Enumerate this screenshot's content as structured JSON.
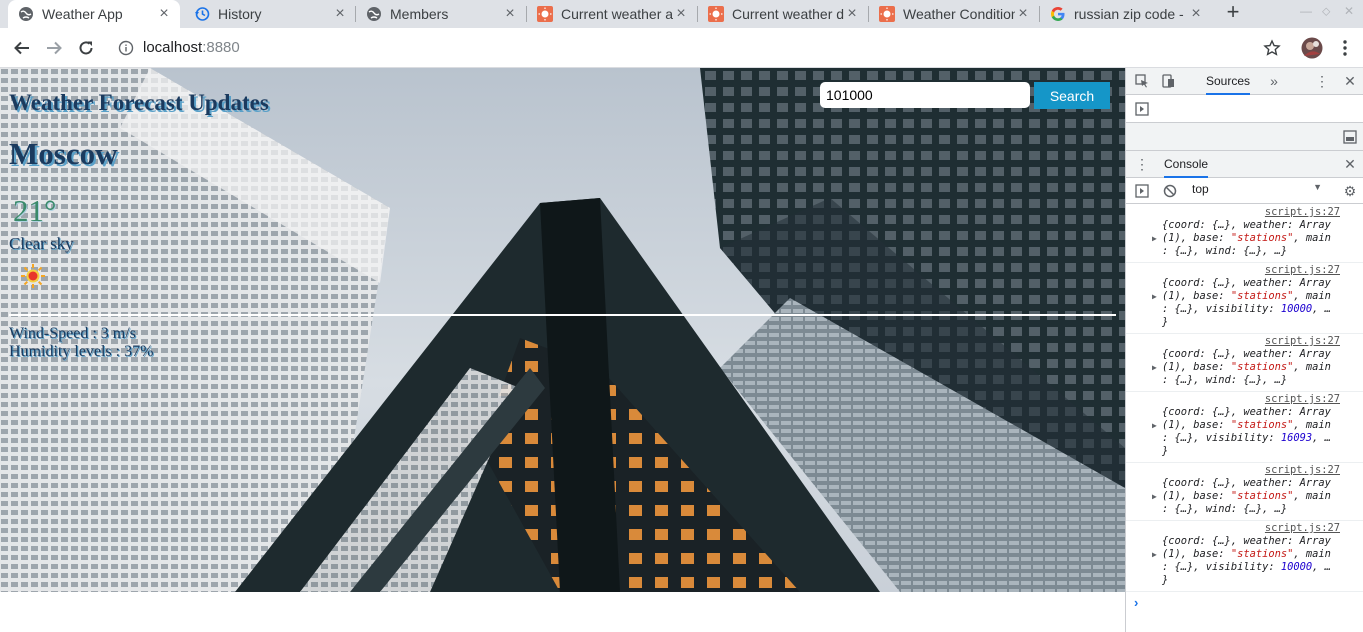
{
  "browser": {
    "tabs": [
      {
        "title": "Weather App",
        "icon": "globe-icon",
        "active": true
      },
      {
        "title": "History",
        "icon": "history-icon",
        "active": false
      },
      {
        "title": "Members",
        "icon": "globe-icon",
        "active": false
      },
      {
        "title": "Current weather ar",
        "icon": "openweather-icon",
        "active": false
      },
      {
        "title": "Current weather da",
        "icon": "openweather-icon",
        "active": false
      },
      {
        "title": "Weather Condition",
        "icon": "openweather-icon",
        "active": false
      },
      {
        "title": "russian zip code - G",
        "icon": "google-icon",
        "active": false
      }
    ],
    "url_host": "localhost",
    "url_port": ":8880"
  },
  "app": {
    "title": "Weather Forecast Updates",
    "search_value": "101000",
    "search_button": "Search",
    "city": "Moscow",
    "temperature": "21°",
    "description": "Clear sky",
    "wind": "Wind-Speed : 3 m/s",
    "humidity": "Humidity levels : 37%"
  },
  "devtools": {
    "top_tab": "Sources",
    "drawer_tab": "Console",
    "context": "top",
    "logs": [
      {
        "source": "script.js:27",
        "line1": "{coord: {…}, weather: Array",
        "line2": "(1), base: ",
        "base": "\"stations\"",
        "line2b": ", main",
        "line3": ": {…}, wind: {…}, …}",
        "line4": ""
      },
      {
        "source": "script.js:27",
        "line1": "{coord: {…}, weather: Array",
        "line2": "(1), base: ",
        "base": "\"stations\"",
        "line2b": ", main",
        "line3": ": {…}, visibility: ",
        "num": "10000",
        "line3b": ", …",
        "line4": "}"
      },
      {
        "source": "script.js:27",
        "line1": "{coord: {…}, weather: Array",
        "line2": "(1), base: ",
        "base": "\"stations\"",
        "line2b": ", main",
        "line3": ": {…}, wind: {…}, …}",
        "line4": ""
      },
      {
        "source": "script.js:27",
        "line1": "{coord: {…}, weather: Array",
        "line2": "(1), base: ",
        "base": "\"stations\"",
        "line2b": ", main",
        "line3": ": {…}, visibility: ",
        "num": "16093",
        "line3b": ", …",
        "line4": "}"
      },
      {
        "source": "script.js:27",
        "line1": "{coord: {…}, weather: Array",
        "line2": "(1), base: ",
        "base": "\"stations\"",
        "line2b": ", main",
        "line3": ": {…}, wind: {…}, …}",
        "line4": ""
      },
      {
        "source": "script.js:27",
        "line1": "{coord: {…}, weather: Array",
        "line2": "(1), base: ",
        "base": "\"stations\"",
        "line2b": ", main",
        "line3": ": {…}, visibility: ",
        "num": "10000",
        "line3b": ", …",
        "line4": "}"
      }
    ],
    "prompt_symbol": "›"
  }
}
